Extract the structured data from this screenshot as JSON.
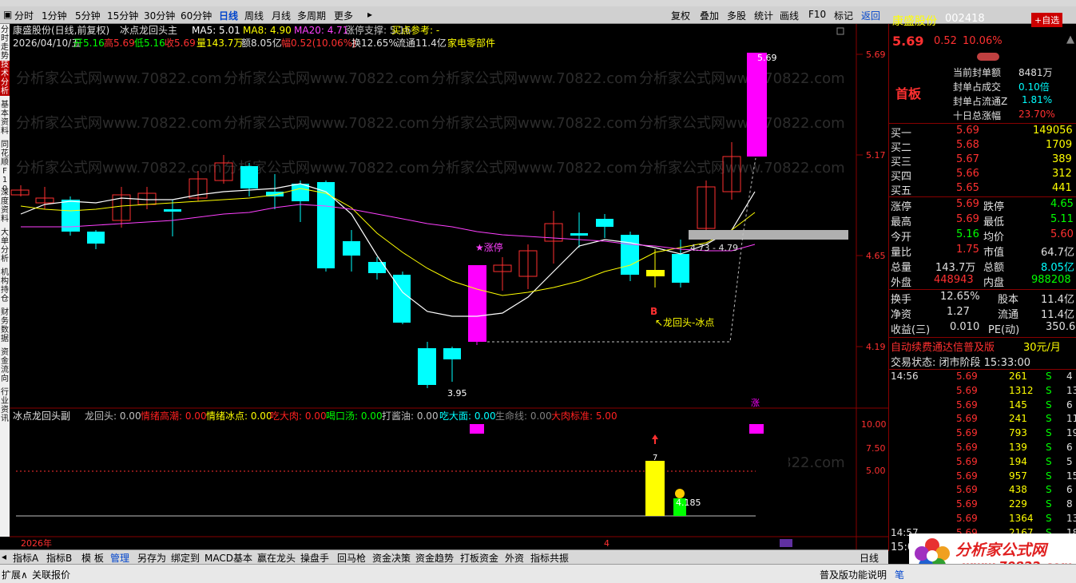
{
  "periods": [
    "分时",
    "1分钟",
    "5分钟",
    "15分钟",
    "30分钟",
    "60分钟",
    "日线",
    "周线",
    "月线",
    "多周期",
    "更多"
  ],
  "active_period": "日线",
  "right_tools": [
    "复权",
    "叠加",
    "多股",
    "统计",
    "画线",
    "F10",
    "标记",
    "返回"
  ],
  "left_vertical": [
    "分时走势",
    "技术分析",
    "基本资料",
    "同花顺F10",
    "深度资料",
    "大单分析",
    "机构持仓",
    "财务数据",
    "资金流向",
    "行业资讯"
  ],
  "main": {
    "stock_title": "康盛股份(日线,前复权)",
    "indicator_name": "冰点龙回头主",
    "ma5": "MA5: 5.01",
    "ma8": "MA8: 4.90",
    "ma20": "MA20: 4.71",
    "zt_support": "涨停支撑: 5.16",
    "buy_ref": "买点参考: -",
    "date": "2026/04/10/五",
    "open": "开5.16",
    "high": "高5.69",
    "low": "低5.16",
    "close": "收5.69",
    "vol": "量143.7万",
    "amount": "额8.05亿",
    "change": "幅0.52(10.06%)",
    "turnover": "换12.65%",
    "float": "流通11.4亿",
    "industry": "家电零部件",
    "price_labels": [
      "5.69",
      "5.17",
      "4.65",
      "4.19"
    ],
    "label_high": "5.69",
    "label_low": "3.95",
    "label_zt": "★涨停",
    "label_b": "B",
    "label_lht": "↖龙回头-冰点",
    "label_range": "4.73 - 4.79",
    "watermark": "分析家公式网www.70822.com"
  },
  "sub": {
    "name": "冰点龙回头副",
    "items": [
      {
        "label": "龙回头: 0.00",
        "color": "#c0c0c0"
      },
      {
        "label": "情绪高潮: 0.00",
        "color": "#ff2020"
      },
      {
        "label": "情绪冰点: 0.00",
        "color": "#ffff00"
      },
      {
        "label": "吃大肉: 0.00",
        "color": "#ff2020"
      },
      {
        "label": "喝口汤: 0.00",
        "color": "#00ff00"
      },
      {
        "label": "打酱油: 0.00",
        "color": "#c0c0c0"
      },
      {
        "label": "吃大面: 0.00",
        "color": "#00ffff"
      },
      {
        "label": "生命线: 0.00",
        "color": "#808080"
      },
      {
        "label": "大肉标准: 5.00",
        "color": "#ff2020"
      }
    ],
    "y_labels": [
      "10.00",
      "7.50",
      "5.00"
    ],
    "bar_label_7": "7",
    "bar_label_185": "4.185",
    "zhang": "涨",
    "year": "2026年",
    "month": "4"
  },
  "rp": {
    "name": "康盛股份",
    "code": "002418",
    "add_btn": "+自选",
    "price": "5.69",
    "change": "0.52",
    "pct": "10.06%",
    "board": "首板",
    "seal": [
      {
        "k": "当前封单额",
        "v": "8481万"
      },
      {
        "k": "封单占成交",
        "v": "0.10倍"
      },
      {
        "k": "封单占流通Z",
        "v": "1.81%"
      },
      {
        "k": "十日总涨幅",
        "v": "23.70%"
      }
    ],
    "buys": [
      {
        "k": "买一",
        "p": "5.69",
        "v": "149056"
      },
      {
        "k": "买二",
        "p": "5.68",
        "v": "1709"
      },
      {
        "k": "买三",
        "p": "5.67",
        "v": "389"
      },
      {
        "k": "买四",
        "p": "5.66",
        "v": "312"
      },
      {
        "k": "买五",
        "p": "5.65",
        "v": "441"
      }
    ],
    "stats": [
      {
        "k1": "涨停",
        "v1": "5.69",
        "c1": "#ff3030",
        "k2": "跌停",
        "v2": "4.65",
        "c2": "#00ff00"
      },
      {
        "k1": "最高",
        "v1": "5.69",
        "c1": "#ff3030",
        "k2": "最低",
        "v2": "5.11",
        "c2": "#00ff00"
      },
      {
        "k1": "今开",
        "v1": "5.16",
        "c1": "#00ff00",
        "k2": "均价",
        "v2": "5.60",
        "c2": "#ff3030"
      },
      {
        "k1": "量比",
        "v1": "1.75",
        "c1": "#ff3030",
        "k2": "市值",
        "v2": "64.7亿",
        "c2": "#e0e0e0"
      },
      {
        "k1": "总量",
        "v1": "143.7万",
        "c1": "#e0e0e0",
        "k2": "总额",
        "v2": "8.05亿",
        "c2": "#00ffff"
      },
      {
        "k1": "外盘",
        "v1": "448943",
        "c1": "#ff3030",
        "k2": "内盘",
        "v2": "988208",
        "c2": "#00ff00"
      }
    ],
    "stats2": [
      {
        "k1": "换手",
        "v1": "12.65%",
        "k2": "股本",
        "v2": "11.4亿"
      },
      {
        "k1": "净资",
        "v1": "1.27",
        "k2": "流通",
        "v2": "11.4亿"
      },
      {
        "k1": "收益(三)",
        "v1": "0.010",
        "k2": "PE(动)",
        "v2": "350.6"
      }
    ],
    "ad": "自动续费通达信普及版",
    "ad_price": "30元/月",
    "trade_state": "交易状态: 闭市阶段 15:33:00",
    "ticks": [
      {
        "t": "14:56",
        "p": "5.69",
        "v": "261",
        "s": "S",
        "n": "4"
      },
      {
        "t": "",
        "p": "5.69",
        "v": "1312",
        "s": "S",
        "n": "13"
      },
      {
        "t": "",
        "p": "5.69",
        "v": "145",
        "s": "S",
        "n": "6"
      },
      {
        "t": "",
        "p": "5.69",
        "v": "241",
        "s": "S",
        "n": "11"
      },
      {
        "t": "",
        "p": "5.69",
        "v": "793",
        "s": "S",
        "n": "19"
      },
      {
        "t": "",
        "p": "5.69",
        "v": "139",
        "s": "S",
        "n": "6"
      },
      {
        "t": "",
        "p": "5.69",
        "v": "194",
        "s": "S",
        "n": "5"
      },
      {
        "t": "",
        "p": "5.69",
        "v": "957",
        "s": "S",
        "n": "15"
      },
      {
        "t": "",
        "p": "5.69",
        "v": "438",
        "s": "S",
        "n": "6"
      },
      {
        "t": "",
        "p": "5.69",
        "v": "229",
        "s": "S",
        "n": "8"
      },
      {
        "t": "",
        "p": "5.69",
        "v": "1364",
        "s": "S",
        "n": "13"
      },
      {
        "t": "14:57",
        "p": "5.69",
        "v": "2167",
        "s": "S",
        "n": "18"
      }
    ],
    "tick_last_time": "15:0"
  },
  "bottom_tabs": [
    "指标A",
    "指标B",
    "模 板",
    "管理",
    "另存为",
    "绑定到",
    "MACD基本",
    "赢在龙头",
    "操盘手",
    "回马枪",
    "资金决策",
    "资金趋势",
    "打板资金",
    "外资",
    "指标共振"
  ],
  "bottom_right": "日线",
  "status": {
    "left1": "扩展∧",
    "left2": "关联报价",
    "right": "普及版功能说明",
    "right2": "笔"
  },
  "logo": {
    "title": "分析家公式网",
    "url": "www.70822.com"
  }
}
